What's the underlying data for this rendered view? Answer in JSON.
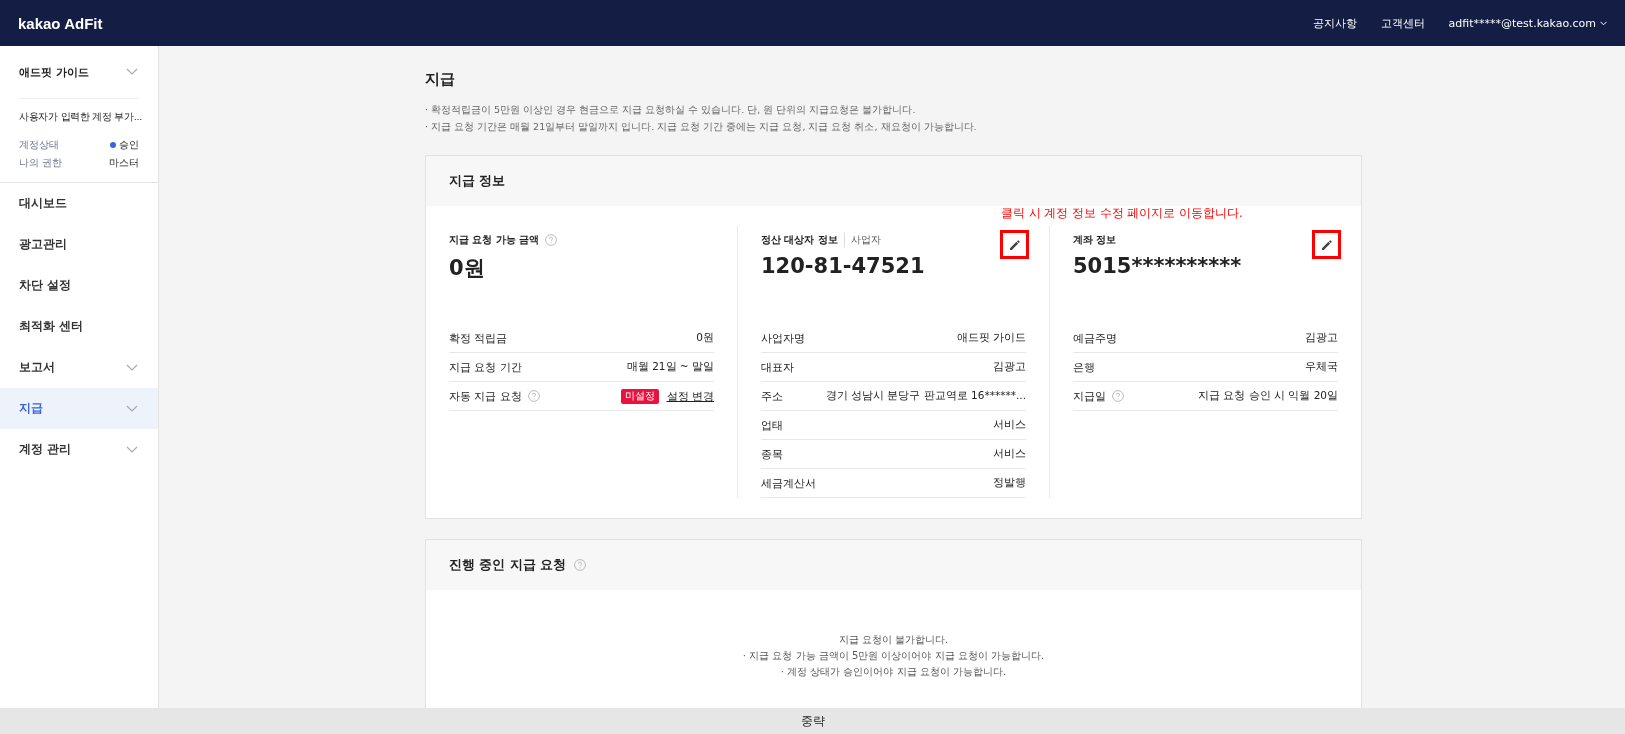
{
  "header": {
    "logo": "kakao AdFit",
    "links": [
      "공지사항",
      "고객센터"
    ],
    "account": "adfit*****@test.kakao.com"
  },
  "sidebar": {
    "guide": {
      "label": "애드핏 가이드",
      "expanded": false
    },
    "account_name": "사용자가 입력한 계정 부가...",
    "meta": [
      {
        "label": "계정상태",
        "value": "승인",
        "kind": "status"
      },
      {
        "label": "나의 권한",
        "value": "마스터",
        "kind": "plain"
      }
    ],
    "items": [
      {
        "label": "대시보드",
        "selected": false,
        "expandable": false
      },
      {
        "label": "광고관리",
        "selected": false,
        "expandable": false
      },
      {
        "label": "차단 설정",
        "selected": false,
        "expandable": false
      },
      {
        "label": "최적화 센터",
        "selected": false,
        "expandable": false
      },
      {
        "label": "보고서",
        "selected": false,
        "expandable": true
      },
      {
        "label": "지급",
        "selected": true,
        "expandable": true
      },
      {
        "label": "계정 관리",
        "selected": false,
        "expandable": true
      }
    ]
  },
  "page": {
    "title": "지급",
    "notes": [
      "· 확정적립금이 5만원 이상인 경우 현금으로 지급 요청하실 수 있습니다. 단, 원 단위의 지급요청은 불가합니다.",
      "· 지급 요청 기간은 매월 21일부터 말일까지 입니다. 지급 요청 기간 중에는 지급 요청, 지급 요청 취소, 재요청이 가능합니다."
    ]
  },
  "payout_info": {
    "title": "지급 정보",
    "annotation": "클릭 시 계정 정보 수정 페이지로 이동합니다.",
    "columns": [
      {
        "title": "지급 요청 가능 금액",
        "help": true,
        "editable": false,
        "value": "0원",
        "rows": [
          {
            "kind": "text",
            "label": "확정 적립금",
            "help": false,
            "value": "0원"
          },
          {
            "kind": "text",
            "label": "지급 요청 기간",
            "help": false,
            "value": "매월 21일 ~ 말일"
          },
          {
            "kind": "status",
            "label": "자동 지급 요청",
            "help": true,
            "badge": "미설정",
            "link": "설정 변경"
          }
        ]
      },
      {
        "title": "정산 대상자 정보",
        "subtitle": "사업자",
        "help": false,
        "editable": true,
        "value": "120-81-47521",
        "rows": [
          {
            "kind": "text",
            "label": "사업자명",
            "help": false,
            "value": "애드핏 가이드"
          },
          {
            "kind": "text",
            "label": "대표자",
            "help": false,
            "value": "김광고"
          },
          {
            "kind": "text",
            "label": "주소",
            "help": false,
            "value": "경기 성남시 분당구 판교역로 16******..."
          },
          {
            "kind": "text",
            "label": "업태",
            "help": false,
            "value": "서비스"
          },
          {
            "kind": "text",
            "label": "종목",
            "help": false,
            "value": "서비스"
          },
          {
            "kind": "text",
            "label": "세금계산서",
            "help": false,
            "value": "정발행"
          }
        ]
      },
      {
        "title": "계좌 정보",
        "help": false,
        "editable": true,
        "value": "5015**********",
        "rows": [
          {
            "kind": "text",
            "label": "예금주명",
            "help": false,
            "value": "김광고"
          },
          {
            "kind": "text",
            "label": "은행",
            "help": false,
            "value": "우체국"
          },
          {
            "kind": "text",
            "label": "지급일",
            "help": true,
            "value": "지급 요청 승인 시 익월 20일"
          }
        ]
      }
    ]
  },
  "pending": {
    "title": "진행 중인 지급 요청",
    "help": true,
    "messages": [
      "지급 요청이 불가합니다.",
      "· 지급 요청 가능 금액이 5만원 이상이어야 지급 요청이 가능합니다.",
      "· 계정 상태가 승인이어야 지급 요청이 가능합니다."
    ]
  },
  "footer": "중략"
}
